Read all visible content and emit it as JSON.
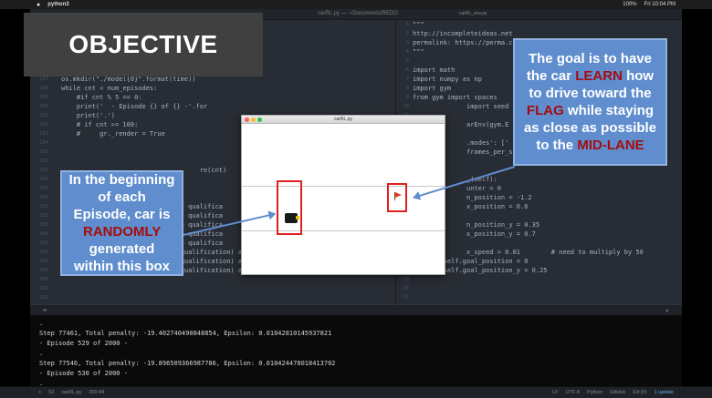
{
  "menubar": {
    "apple": "",
    "app_name": "python3",
    "right_items": [
      "100%",
      "Fri 10:04 PM"
    ]
  },
  "editor": {
    "window_title": "carRL.py — ~/Documents/REDO",
    "right_tab_title": "carRL_env.py",
    "left_line_numbers": [
      "181",
      "182",
      "183",
      "184",
      "185",
      "186",
      "187",
      "188",
      "189",
      "190",
      "191",
      "192",
      "193",
      "194",
      "195",
      "196",
      "197",
      "198",
      "199",
      "200",
      "201",
      "202",
      "203",
      "204",
      "205",
      "206",
      "207",
      "208",
      "209",
      "210",
      "211"
    ],
    "left_code": [
      "",
      "EPSILON, MIN_EPSILON,",
      "",
      "",
      "now = datetime.datetime.now()",
      "time = now.strftime(\"%Y%m%d-%H-%M\")",
      "os.mkdir(\"./model{0}\".format(time))",
      "while cnt < num_episodes:",
      "    #if cnt % 5 == 0:",
      "    print('  - Episode {} of {} -'.for",
      "    print('.')",
      "    # if cnt >= 100:",
      "    #     gr._render = True",
      "",
      "",
      "",
      "                                    re(cnt)",
      "",
      "",
      "",
      "                        e[cnt] > qualifica",
      "                  store[cnt-1] > qualifica",
      "                  store[cnt-2] > qualifica",
      "                  store[cnt-3] > qualifica",
      "                  store[cnt-4] > qualifica",
      "    (gr._reward_store[cnt-5] > qualification) and\\",
      "    (gr._reward_store[cnt-6] > qualification) and\\",
      "    (gr._reward_store[cnt-7] > qualification) and\\",
      "",
      "",
      ""
    ],
    "right_line_numbers": [
      "1",
      "2",
      "3",
      "4",
      "5",
      "6",
      "7",
      "8",
      "9",
      "10",
      "11",
      "12",
      "13",
      "14",
      "15",
      "16",
      "17",
      "18",
      "19",
      "20",
      "21",
      "22",
      "23",
      "24",
      "25",
      "26",
      "27",
      "28",
      "29",
      "30",
      "31"
    ],
    "right_code": [
      "\"\"\"",
      "http://incompleteideas.net",
      "permalink: https://perma.c",
      "\"\"\"",
      "",
      "import math",
      "import numpy as np",
      "import gym",
      "from gym import spaces",
      "              import seed",
      "",
      "              arEnv(gym.E",
      "",
      "              .modes': ['",
      "              frames_per_se",
      "",
      "",
      "              _(self):",
      "              unter = 0",
      "              n_position = -1.2",
      "              x_position = 0.6",
      "",
      "              n_position_y = 0.35",
      "              x_position_y = 0.7",
      "",
      "              x_speed = 0.01        # need to multiply by 50",
      "        self.goal_position = 0",
      "        self.goal_position_y = 0.25",
      "",
      "",
      ""
    ]
  },
  "terminal": {
    "toolbar_icon": "⌨",
    "close_icon": "✕",
    "lines": [
      ".",
      "Step 77461, Total penalty: -19.402740490848854, Epsilon: 0.01042810145937821",
      "  - Episode 529 of 2000 -",
      ".",
      "Step 77546, Total penalty: -19.896509366987786, Epsilon: 0.010424478018413702",
      "  - Episode 530 of 2000 -",
      "."
    ]
  },
  "statusbar": {
    "left": [
      "+",
      "52",
      "carRL.py",
      "200:44"
    ],
    "right": [
      "LF",
      "UTF-8",
      "Python",
      "GitHub",
      "Git (0)",
      "1 update"
    ]
  },
  "objective": {
    "label": "OBJECTIVE"
  },
  "car_window": {
    "title": "carRL.py"
  },
  "callout_goal": {
    "parts": [
      "The goal is to have the car ",
      "LEARN",
      " how to drive toward the ",
      "FLAG",
      " while staying as close as possible to the ",
      "MID-LANE"
    ]
  },
  "callout_random": {
    "parts": [
      "In the beginning of each Episode, car is ",
      "RANDOMLY",
      " generated within this box"
    ]
  },
  "colors": {
    "callout_bg": "#5f8dcd",
    "highlight": "#a40d0d",
    "box_red": "#e02020",
    "objective_bg": "#404040"
  }
}
